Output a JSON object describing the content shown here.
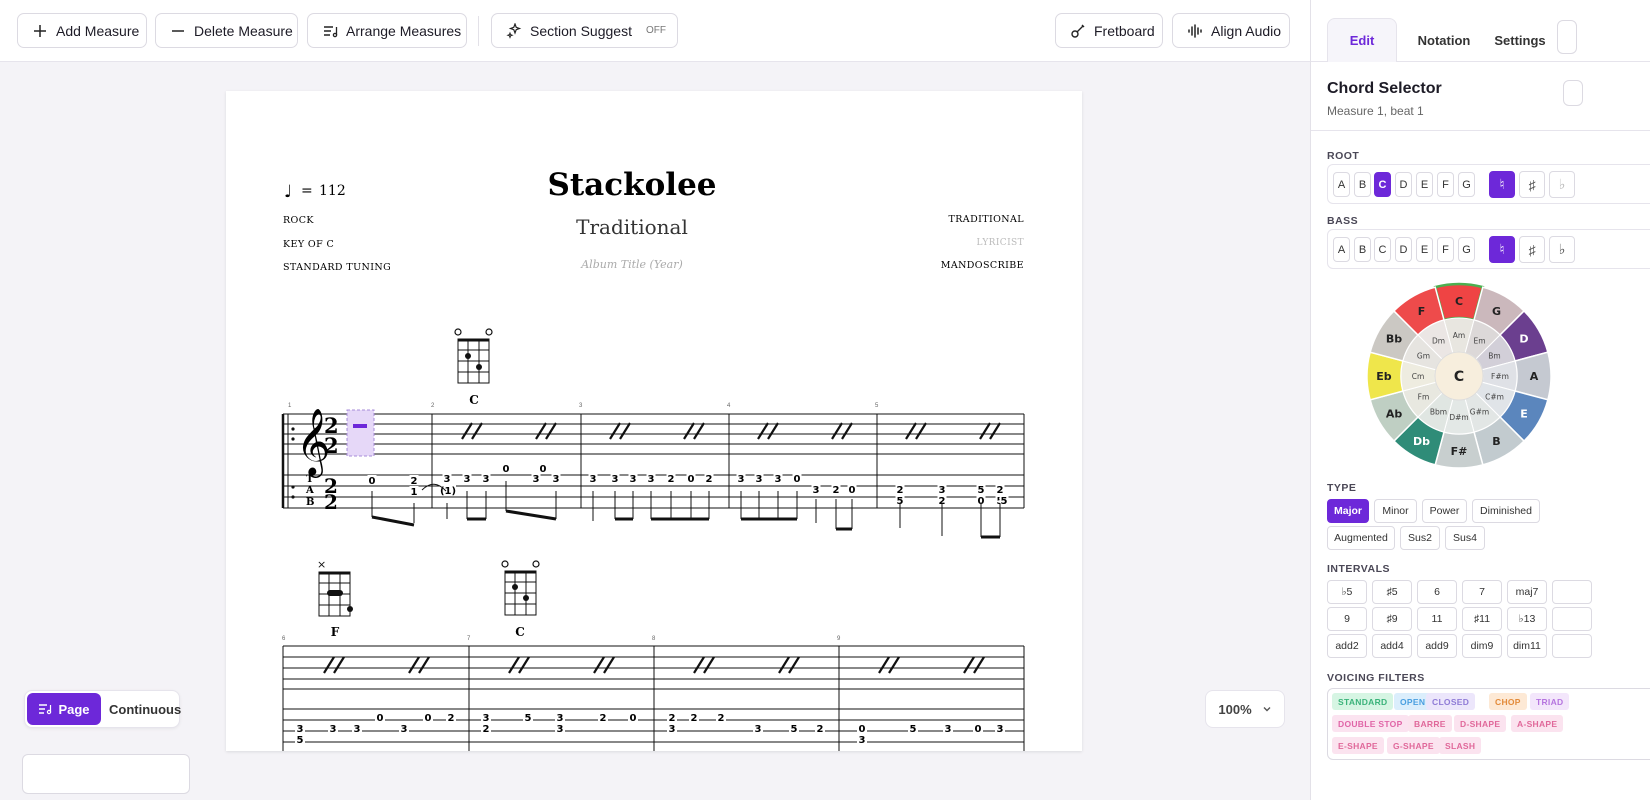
{
  "toolbar": {
    "add_measure": "Add Measure",
    "delete_measure": "Delete Measure",
    "arrange_measures": "Arrange Measures",
    "section_suggest": "Section Suggest",
    "section_suggest_state": "OFF",
    "fretboard": "Fretboard",
    "align_audio": "Align Audio"
  },
  "score": {
    "tempo_symbol": "♩",
    "tempo_eq": "=",
    "tempo": "112",
    "title": "Stackolee",
    "subtitle": "Traditional",
    "album": "Album Title (Year)",
    "style": "ROCK",
    "key": "KEY OF C",
    "tuning": "STANDARD TUNING",
    "composer": "TRADITIONAL",
    "lyricist": "LYRICIST",
    "arranger": "MANDOSCRIBE",
    "time_sig": "2",
    "tab_letters": [
      "T",
      "A",
      "B"
    ],
    "chords": [
      {
        "name": "C",
        "marks": "o o"
      },
      {
        "name": "F",
        "marks": "×"
      },
      {
        "name": "C",
        "marks": "o o"
      }
    ],
    "measure_numbers": [
      "1",
      "2",
      "3",
      "4",
      "5",
      "6",
      "7",
      "8",
      "9"
    ],
    "tab_numbers_row1": [
      "0",
      "2",
      "1",
      "3",
      "(1)",
      "3",
      "3",
      "0",
      "3",
      "0",
      "3",
      "3",
      "3",
      "3",
      "3",
      "2",
      "0",
      "2",
      "3",
      "3",
      "3",
      "0",
      "3",
      "2",
      "0",
      "2",
      "5",
      "3",
      "2",
      "5",
      "0",
      "2",
      "5",
      "5"
    ],
    "tab_numbers_row2": [
      "3",
      "5",
      "3",
      "3",
      "0",
      "3",
      "0",
      "2",
      "3",
      "2",
      "5",
      "3",
      "3",
      "2",
      "0",
      "2",
      "3",
      "2",
      "2",
      "3",
      "5",
      "2",
      "0",
      "3",
      "5",
      "3",
      "0",
      "3"
    ]
  },
  "view": {
    "page": "Page",
    "continuous": "Continuous",
    "zoom": "100%"
  },
  "panel": {
    "tabs": [
      "Edit",
      "Notation",
      "Settings"
    ],
    "title": "Chord Selector",
    "subtitle": "Measure 1, beat 1",
    "root_label": "ROOT",
    "bass_label": "BASS",
    "notes": [
      "A",
      "B",
      "C",
      "D",
      "E",
      "F",
      "G"
    ],
    "accidentals": [
      "♮",
      "♯",
      "♭"
    ],
    "circle_outer": [
      "C",
      "G",
      "D",
      "A",
      "E",
      "B",
      "F#",
      "Db",
      "Ab",
      "Eb",
      "Bb",
      "F"
    ],
    "circle_inner": [
      "Am",
      "Em",
      "Bm",
      "F#m",
      "C#m",
      "G#m",
      "D#m",
      "Bbm",
      "Fm",
      "Cm",
      "Gm",
      "Dm"
    ],
    "circle_center": "C",
    "type_label": "TYPE",
    "types": [
      "Major",
      "Minor",
      "Power",
      "Diminished",
      "Augmented",
      "Sus2",
      "Sus4"
    ],
    "intervals_label": "INTERVALS",
    "intervals": [
      "♭5",
      "♯5",
      "6",
      "7",
      "maj7",
      "9",
      "♯9",
      "11",
      "♯11",
      "♭13",
      "add2",
      "add4",
      "add9",
      "dim9",
      "dim11"
    ],
    "voicing_label": "VOICING FILTERS",
    "voicings": [
      "STANDARD",
      "OPEN",
      "CLOSED",
      "CHOP",
      "TRIAD",
      "DOUBLE STOP",
      "BARRE",
      "D-SHAPE",
      "A-SHAPE",
      "E-SHAPE",
      "G-SHAPE",
      "SLASH"
    ],
    "colors": {
      "accent": "#6d28d9",
      "C": "#ef4444",
      "G": "#cbb8bc",
      "D": "#6b3f8f",
      "A": "#c5c9d1",
      "E": "#5b86bd",
      "B": "#c2cbcf",
      "F#": "#c8cfcf",
      "Db": "#2f8c78",
      "Ab": "#bfcfc3",
      "Eb": "#efe64b",
      "Bb": "#cbc8c3",
      "F": "#ee4b4b"
    }
  }
}
